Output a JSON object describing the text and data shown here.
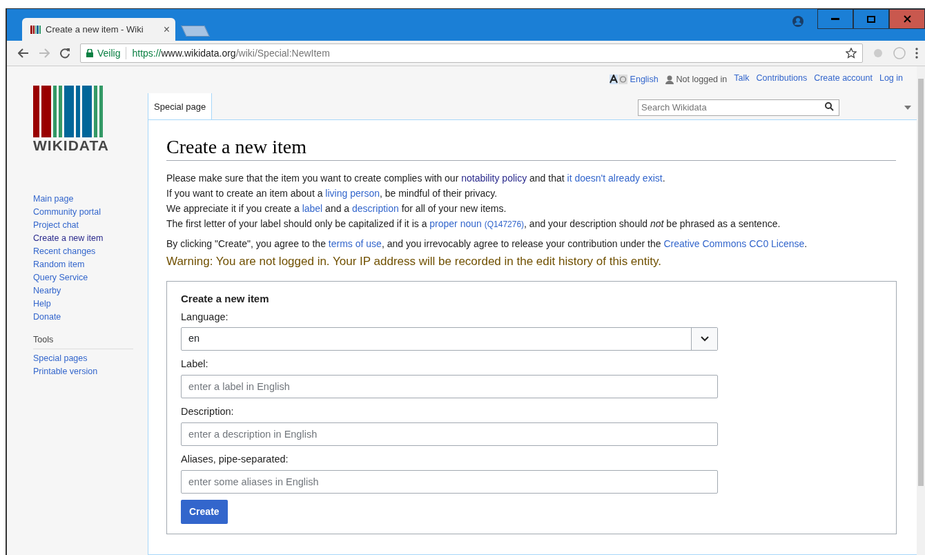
{
  "browser": {
    "tab_title": "Create a new item - Wiki",
    "tab_close": "×",
    "security_label": "Veilig",
    "url": {
      "scheme": "https://",
      "host": "www.wikidata.org",
      "path": "/wiki/Special:NewItem"
    }
  },
  "personal_tools": [
    {
      "kind": "language",
      "text": "English"
    },
    {
      "kind": "user",
      "text": "Not logged in"
    },
    {
      "kind": "link",
      "text": "Talk"
    },
    {
      "kind": "link",
      "text": "Contributions"
    },
    {
      "kind": "link",
      "text": "Create account"
    },
    {
      "kind": "link",
      "text": "Log in"
    }
  ],
  "logo": {
    "wordmark": "WIKIDATA"
  },
  "tabs": [
    {
      "label": "Special page",
      "selected": true
    }
  ],
  "search": {
    "placeholder": "Search Wikidata"
  },
  "sidebar": {
    "items": [
      {
        "label": "Main page",
        "visited": false
      },
      {
        "label": "Community portal",
        "visited": false
      },
      {
        "label": "Project chat",
        "visited": false
      },
      {
        "label": "Create a new item",
        "visited": true
      },
      {
        "label": "Recent changes",
        "visited": false
      },
      {
        "label": "Random item",
        "visited": false
      },
      {
        "label": "Query Service",
        "visited": false
      },
      {
        "label": "Nearby",
        "visited": false
      },
      {
        "label": "Help",
        "visited": false
      },
      {
        "label": "Donate",
        "visited": false
      }
    ],
    "tools": {
      "heading": "Tools",
      "items": [
        {
          "label": "Special pages",
          "visited": false
        },
        {
          "label": "Printable version",
          "visited": false
        }
      ]
    }
  },
  "page_title": "Create a new item",
  "intro": [
    [
      {
        "kind": "text",
        "text": "Please make sure that the item you want to create complies with our"
      },
      {
        "kind": "link",
        "text": "notability policy",
        "visited": true
      },
      {
        "kind": "text",
        "text": "and that"
      },
      {
        "kind": "link",
        "text": "it doesn't already exist",
        "visited": false
      },
      {
        "kind": "text",
        "text": "."
      }
    ],
    [
      {
        "kind": "text",
        "text": "If you want to create an item about a"
      },
      {
        "kind": "link",
        "text": "living person",
        "visited": false
      },
      {
        "kind": "text",
        "text": ", be mindful of their privacy."
      }
    ],
    [
      {
        "kind": "text",
        "text": "We appreciate it if you create a"
      },
      {
        "kind": "link",
        "text": "label",
        "visited": false
      },
      {
        "kind": "text",
        "text": "and a"
      },
      {
        "kind": "link",
        "text": "description",
        "visited": false
      },
      {
        "kind": "text",
        "text": "for all of your new items."
      }
    ],
    [
      {
        "kind": "text",
        "text": "The first letter of your label should only be capitalized if it is a"
      },
      {
        "kind": "link",
        "text": "proper noun",
        "visited": false
      },
      {
        "kind": "small-link",
        "text": "(Q147276)",
        "visited": false
      },
      {
        "kind": "text",
        "text": ", and your description should *not* be phrased as a sentence."
      }
    ]
  ],
  "terms": [
    {
      "kind": "text",
      "text": "By clicking \"Create\", you agree to the"
    },
    {
      "kind": "link",
      "text": "terms of use",
      "visited": false
    },
    {
      "kind": "text",
      "text": ", and you irrevocably agree to release your contribution under the"
    },
    {
      "kind": "link",
      "text": "Creative Commons CC0 License",
      "visited": false
    },
    {
      "kind": "text",
      "text": "."
    }
  ],
  "warning": "Warning: You are not logged in. Your IP address will be recorded in the edit history of this entity.",
  "form": {
    "title": "Create a new item",
    "fields": [
      {
        "kind": "select",
        "label": "Language:",
        "value": "en"
      },
      {
        "kind": "text",
        "label": "Label:",
        "placeholder": "enter a label in English"
      },
      {
        "kind": "text",
        "label": "Description:",
        "placeholder": "enter a description in English"
      },
      {
        "kind": "text",
        "label": "Aliases, pipe-separated:",
        "placeholder": "enter some aliases in English"
      }
    ],
    "submit": "Create"
  }
}
